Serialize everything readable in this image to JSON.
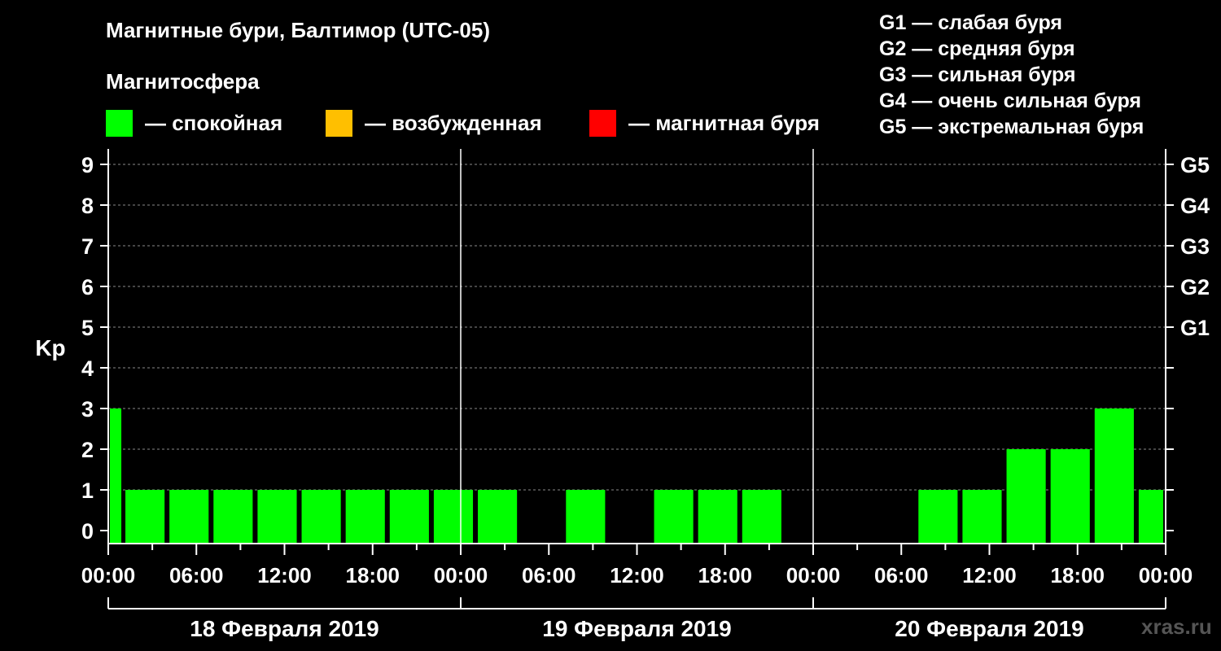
{
  "title": "Магнитные бури, Балтимор (UTC-05)",
  "subtitle": "Магнитосфера",
  "legend": [
    {
      "label": "— спокойная",
      "color": "#00ff00"
    },
    {
      "label": "— возбужденная",
      "color": "#ffbf00"
    },
    {
      "label": "— магнитная буря",
      "color": "#ff0000"
    }
  ],
  "g_legend": [
    "G1 — слабая буря",
    "G2 — средняя буря",
    "G3 — сильная буря",
    "G4 — очень сильная буря",
    "G5 — экстремальная буря"
  ],
  "watermark": "xras.ru",
  "chart_data": {
    "type": "bar",
    "ylabel": "Kp",
    "ylim": [
      0,
      9
    ],
    "yticks": [
      0,
      1,
      2,
      3,
      4,
      5,
      6,
      7,
      8,
      9
    ],
    "right_ticks": [
      {
        "value": 5,
        "label": "G1"
      },
      {
        "value": 6,
        "label": "G2"
      },
      {
        "value": 7,
        "label": "G3"
      },
      {
        "value": 8,
        "label": "G4"
      },
      {
        "value": 9,
        "label": "G5"
      }
    ],
    "x_tick_labels": [
      "00:00",
      "06:00",
      "12:00",
      "18:00",
      "00:00",
      "06:00",
      "12:00",
      "18:00",
      "00:00",
      "06:00",
      "12:00",
      "18:00",
      "00:00"
    ],
    "days": [
      "18 Февраля 2019",
      "19 Февраля 2019",
      "20 Февраля 2019"
    ],
    "bar_color": "#00ff00",
    "grid": "dashed horizontal",
    "bars": [
      {
        "start_hour": 0,
        "end_hour": 1,
        "value": 3
      },
      {
        "start_hour": 1,
        "end_hour": 4,
        "value": 1
      },
      {
        "start_hour": 4,
        "end_hour": 7,
        "value": 1
      },
      {
        "start_hour": 7,
        "end_hour": 10,
        "value": 1
      },
      {
        "start_hour": 10,
        "end_hour": 13,
        "value": 1
      },
      {
        "start_hour": 13,
        "end_hour": 16,
        "value": 1
      },
      {
        "start_hour": 16,
        "end_hour": 19,
        "value": 1
      },
      {
        "start_hour": 19,
        "end_hour": 22,
        "value": 1
      },
      {
        "start_hour": 22,
        "end_hour": 25,
        "value": 1
      },
      {
        "start_hour": 25,
        "end_hour": 28,
        "value": 1
      },
      {
        "start_hour": 28,
        "end_hour": 31,
        "value": 0
      },
      {
        "start_hour": 31,
        "end_hour": 34,
        "value": 1
      },
      {
        "start_hour": 34,
        "end_hour": 37,
        "value": 0
      },
      {
        "start_hour": 37,
        "end_hour": 40,
        "value": 1
      },
      {
        "start_hour": 40,
        "end_hour": 43,
        "value": 1
      },
      {
        "start_hour": 43,
        "end_hour": 46,
        "value": 1
      },
      {
        "start_hour": 46,
        "end_hour": 49,
        "value": 0
      },
      {
        "start_hour": 49,
        "end_hour": 52,
        "value": 0
      },
      {
        "start_hour": 52,
        "end_hour": 55,
        "value": 0
      },
      {
        "start_hour": 55,
        "end_hour": 58,
        "value": 1
      },
      {
        "start_hour": 58,
        "end_hour": 61,
        "value": 1
      },
      {
        "start_hour": 61,
        "end_hour": 64,
        "value": 2
      },
      {
        "start_hour": 64,
        "end_hour": 67,
        "value": 2
      },
      {
        "start_hour": 67,
        "end_hour": 70,
        "value": 3
      },
      {
        "start_hour": 70,
        "end_hour": 72,
        "value": 1
      }
    ]
  }
}
